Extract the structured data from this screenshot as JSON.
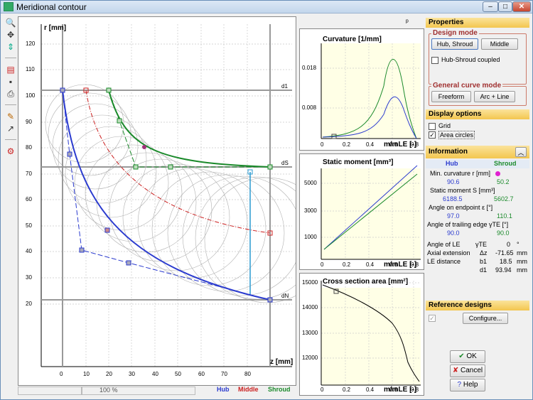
{
  "window": {
    "title": "Meridional contour"
  },
  "toolbar": {
    "icons": [
      "zoom-in-icon",
      "pan-icon",
      "fit-icon",
      "export-icon",
      "save-icon",
      "print-icon",
      "edit-icon",
      "arrow-icon",
      "settings-icon"
    ]
  },
  "main_plot": {
    "ylabel": "r [mm]",
    "xlabel": "z [mm]",
    "y_ticks": [
      "120",
      "110",
      "100",
      "90",
      "80",
      "70",
      "60",
      "50",
      "40",
      "30",
      "20"
    ],
    "x_ticks": [
      "0",
      "10",
      "20",
      "30",
      "40",
      "50",
      "60",
      "70",
      "80"
    ],
    "markers": {
      "d1": "d1",
      "dS": "dS",
      "dN": "dN"
    }
  },
  "statusbar": {
    "zoom": "100 %",
    "hub": "Hub",
    "middle": "Middle",
    "shroud": "Shroud"
  },
  "minis": {
    "pin": "ᵖ",
    "curvature": {
      "title": "Curvature [1/mm]",
      "xlabel": "m/mLE [-]",
      "y_ticks": [
        "0.018",
        "0.008"
      ],
      "x_ticks": [
        "0",
        "0.2",
        "0.4",
        "0.6",
        "0.8"
      ]
    },
    "static": {
      "title": "Static moment [mm³]",
      "xlabel": "m/mLE [-]",
      "y_ticks": [
        "5000",
        "3000",
        "1000"
      ],
      "x_ticks": [
        "0",
        "0.2",
        "0.4",
        "0.6",
        "0.8"
      ]
    },
    "cross": {
      "title": "Cross section area [mm²]",
      "xlabel": "m/mLE [-]",
      "y_ticks": [
        "15000",
        "14000",
        "13000",
        "12000"
      ],
      "x_ticks": [
        "0",
        "0.2",
        "0.4",
        "0.6",
        "0.8"
      ]
    }
  },
  "panel": {
    "properties": "Properties",
    "design_mode": "Design mode",
    "hub_shroud_btn": "Hub, Shroud",
    "middle_btn": "Middle",
    "coupled": "Hub-Shroud coupled",
    "general_curve_mode": "General curve mode",
    "freeform_btn": "Freeform",
    "arcline_btn": "Arc + Line",
    "display_options": "Display options",
    "grid": "Grid",
    "area_circles": "Area circles",
    "information": "Information",
    "info_hub": "Hub",
    "info_shroud": "Shroud",
    "min_curv_label": "Min. curvature r [mm]",
    "min_curv_hub": "90.6",
    "min_curv_shroud": "50.2",
    "static_label": "Static moment S [mm³]",
    "static_hub": "6188.5",
    "static_shroud": "5602.7",
    "angle_end_label": "Angle on endpoint ε [°]",
    "angle_end_hub": "97.0",
    "angle_end_shroud": "110.1",
    "angle_te_label": "Angle of trailing edge γTE [°]",
    "angle_te_hub": "90.0",
    "angle_te_shroud": "90.0",
    "le_angle_label": "Angle of LE",
    "le_angle_sym": "γTE",
    "le_angle_val": "0",
    "le_angle_unit": "°",
    "axial_label": "Axial extension",
    "axial_sym": "Δz",
    "axial_val": "-71.65",
    "axial_unit": "mm",
    "le_dist_label": "LE distance",
    "le_dist_sym": "b1",
    "le_dist_val": "18.5",
    "le_dist_unit": "mm",
    "d1_sym": "d1",
    "d1_val": "93.94",
    "d1_unit": "mm",
    "reference_designs": "Reference designs",
    "configure_btn": "Configure...",
    "ok_btn": "OK",
    "cancel_btn": "Cancel",
    "help_btn": "Help"
  },
  "colors": {
    "hub": "#2b3bcf",
    "middle": "#cc2020",
    "shroud": "#1b8a2b"
  }
}
